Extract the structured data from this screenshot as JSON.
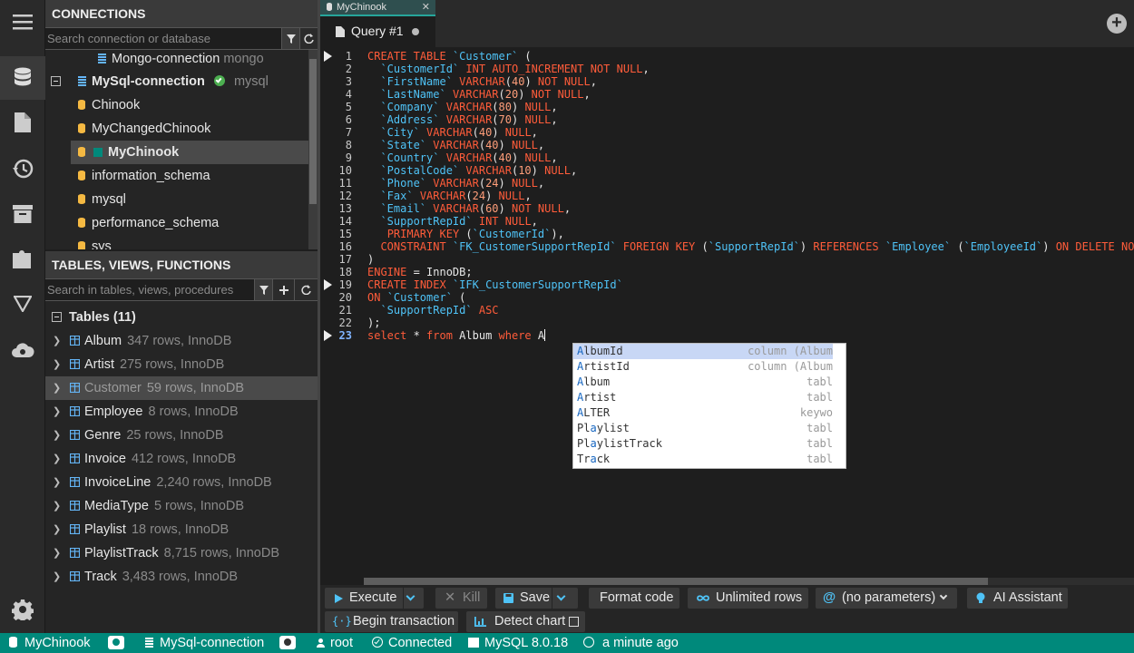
{
  "connections": {
    "title": "CONNECTIONS",
    "search_placeholder": "Search connection or database",
    "items": [
      {
        "name": "Mongo-connection",
        "engine": "mongo"
      },
      {
        "name": "MySql-connection",
        "engine": "mysql"
      }
    ],
    "databases": [
      "Chinook",
      "MyChangedChinook",
      "MyChinook",
      "information_schema",
      "mysql",
      "performance_schema",
      "sys"
    ]
  },
  "tables_panel": {
    "title": "TABLES, VIEWS, FUNCTIONS",
    "search_placeholder": "Search in tables, views, procedures",
    "group_label": "Tables (11)",
    "tables": [
      {
        "name": "Album",
        "info": "347 rows, InnoDB"
      },
      {
        "name": "Artist",
        "info": "275 rows, InnoDB"
      },
      {
        "name": "Customer",
        "info": "59 rows, InnoDB"
      },
      {
        "name": "Employee",
        "info": "8 rows, InnoDB"
      },
      {
        "name": "Genre",
        "info": "25 rows, InnoDB"
      },
      {
        "name": "Invoice",
        "info": "412 rows, InnoDB"
      },
      {
        "name": "InvoiceLine",
        "info": "2,240 rows, InnoDB"
      },
      {
        "name": "MediaType",
        "info": "5 rows, InnoDB"
      },
      {
        "name": "Playlist",
        "info": "18 rows, InnoDB"
      },
      {
        "name": "PlaylistTrack",
        "info": "8,715 rows, InnoDB"
      },
      {
        "name": "Track",
        "info": "3,483 rows, InnoDB"
      }
    ]
  },
  "tabs": {
    "connection_tab": "MyChinook",
    "query_tab": "Query #1"
  },
  "editor": {
    "line_numbers": [
      "1",
      "2",
      "3",
      "4",
      "5",
      "6",
      "7",
      "8",
      "9",
      "10",
      "11",
      "12",
      "13",
      "14",
      "15",
      "16",
      "17",
      "18",
      "19",
      "20",
      "21",
      "22",
      "23"
    ],
    "lines": [
      "CREATE TABLE `Customer` (",
      "  `CustomerId` INT AUTO_INCREMENT NOT NULL,",
      "  `FirstName` VARCHAR(40) NOT NULL,",
      "  `LastName` VARCHAR(20) NOT NULL,",
      "  `Company` VARCHAR(80) NULL,",
      "  `Address` VARCHAR(70) NULL,",
      "  `City` VARCHAR(40) NULL,",
      "  `State` VARCHAR(40) NULL,",
      "  `Country` VARCHAR(40) NULL,",
      "  `PostalCode` VARCHAR(10) NULL,",
      "  `Phone` VARCHAR(24) NULL,",
      "  `Fax` VARCHAR(24) NULL,",
      "  `Email` VARCHAR(60) NOT NULL,",
      "  `SupportRepId` INT NULL,",
      "   PRIMARY KEY (`CustomerId`),",
      "  CONSTRAINT `FK_CustomerSupportRepId` FOREIGN KEY (`SupportRepId`) REFERENCES `Employee` (`EmployeeId`) ON DELETE NO",
      ")",
      "ENGINE = InnoDB;",
      "CREATE INDEX `IFK_CustomerSupportRepId`",
      "ON `Customer` (",
      "  `SupportRepId` ASC",
      ");",
      "select * from Album where A"
    ]
  },
  "autocomplete": [
    {
      "label": "AlbumId",
      "kind": "column (Album"
    },
    {
      "label": "ArtistId",
      "kind": "column (Album"
    },
    {
      "label": "Album",
      "kind": "tabl"
    },
    {
      "label": "Artist",
      "kind": "tabl"
    },
    {
      "label": "ALTER",
      "kind": "keywo"
    },
    {
      "label": "Playlist",
      "kind": "tabl"
    },
    {
      "label": "PlaylistTrack",
      "kind": "tabl"
    },
    {
      "label": "Track",
      "kind": "tabl"
    }
  ],
  "toolbar": {
    "execute": "Execute",
    "kill": "Kill",
    "save": "Save",
    "format": "Format code",
    "limit": "Unlimited rows",
    "params": "(no parameters)",
    "ai": "AI Assistant",
    "transaction": "Begin transaction",
    "chart": "Detect chart"
  },
  "status": {
    "database": "MyChinook",
    "connection": "MySql-connection",
    "user": "root",
    "state": "Connected",
    "server": "MySQL 8.0.18",
    "time": "a minute ago"
  },
  "colors": {
    "accent": "#00897b",
    "keyword": "#ff5c3a",
    "identifier": "#4fc3f7",
    "number": "#ff9e7a",
    "connected": "#4caf50",
    "table_icon": "#64b5f6",
    "db_icon": "#f5b942"
  }
}
